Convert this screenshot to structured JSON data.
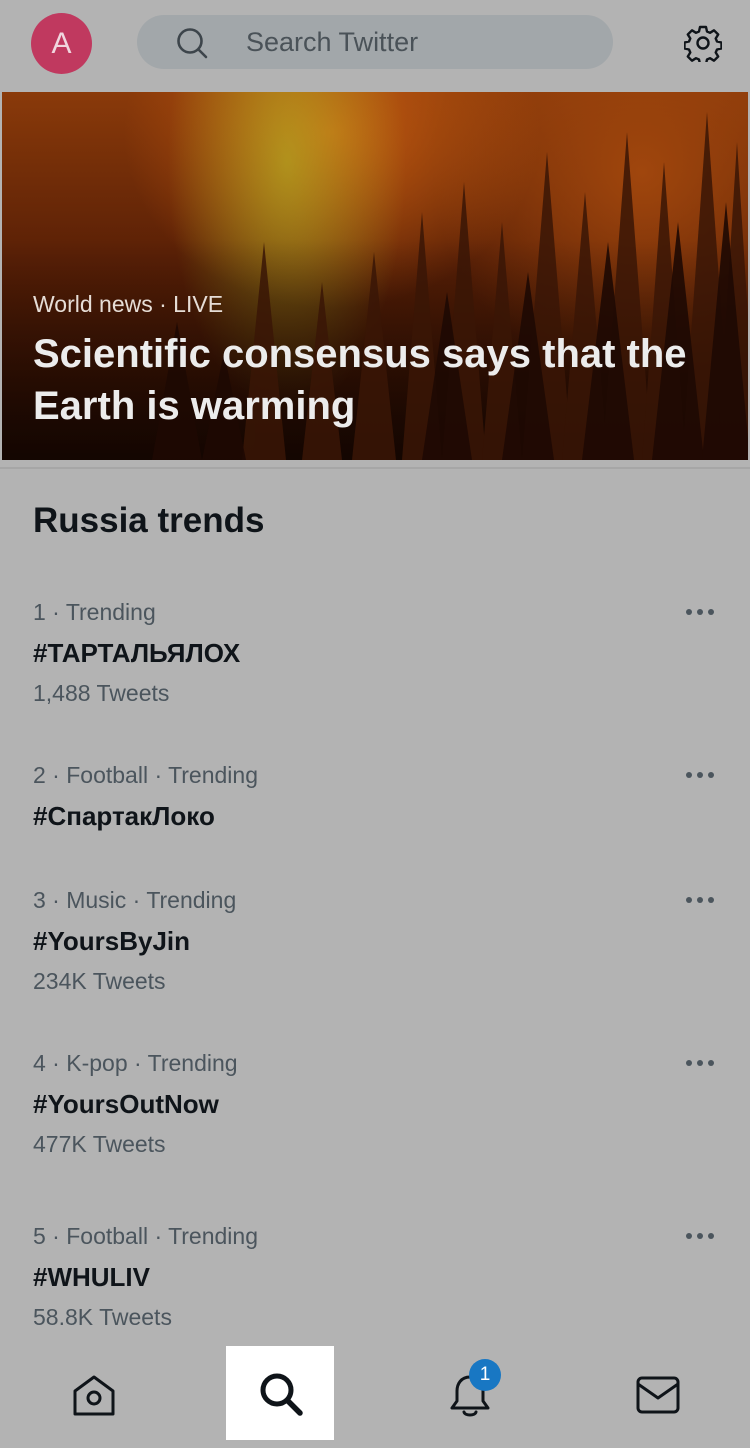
{
  "header": {
    "avatar_letter": "A",
    "search_placeholder": "Search Twitter",
    "icons": {
      "search": "search-icon",
      "settings": "gear-icon"
    }
  },
  "hero": {
    "label": "World news · LIVE",
    "title": "Scientific consensus says that the Earth is warming"
  },
  "section": {
    "title": "Russia trends"
  },
  "trends": [
    {
      "meta": "1 · Trending",
      "name": "#ТАРТАЛЬЯЛОХ",
      "count": "1,488 Tweets"
    },
    {
      "meta": "2 · Football · Trending",
      "name": "#СпартакЛоко",
      "count": ""
    },
    {
      "meta": "3 · Music · Trending",
      "name": "#YoursByJin",
      "count": "234K Tweets"
    },
    {
      "meta": "4 · K-pop · Trending",
      "name": "#YoursOutNow",
      "count": "477K Tweets"
    },
    {
      "meta": "5 · Football · Trending",
      "name": "#WHULIV",
      "count": "58.8K Tweets"
    }
  ],
  "nav": {
    "items": [
      "home-icon",
      "search-icon",
      "bell-icon",
      "mail-icon"
    ],
    "active": "search-icon",
    "notification_badge": "1"
  },
  "colors": {
    "background": "#b3b3b3",
    "avatar": "#c0395f",
    "badge": "#1877c3",
    "text": "#0f1419",
    "muted_text": "#4b555d"
  }
}
